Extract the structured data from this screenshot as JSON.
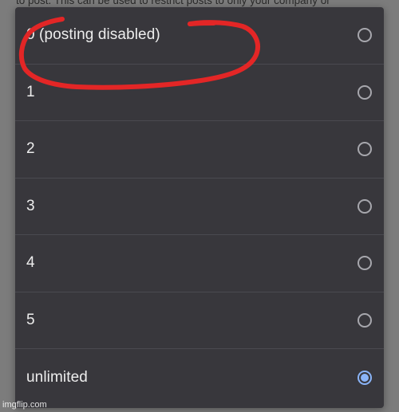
{
  "background": {
    "text": "to post. This can be used to restrict posts to only your company or"
  },
  "dialog": {
    "options": [
      {
        "label": "0 (posting disabled)",
        "selected": false
      },
      {
        "label": "1",
        "selected": false
      },
      {
        "label": "2",
        "selected": false
      },
      {
        "label": "3",
        "selected": false
      },
      {
        "label": "4",
        "selected": false
      },
      {
        "label": "5",
        "selected": false
      },
      {
        "label": "unlimited",
        "selected": true
      }
    ]
  },
  "colors": {
    "dialog_bg": "#38373c",
    "accent": "#8ab4f8",
    "annotation": "#e32626"
  },
  "watermark": "imgflip.com"
}
